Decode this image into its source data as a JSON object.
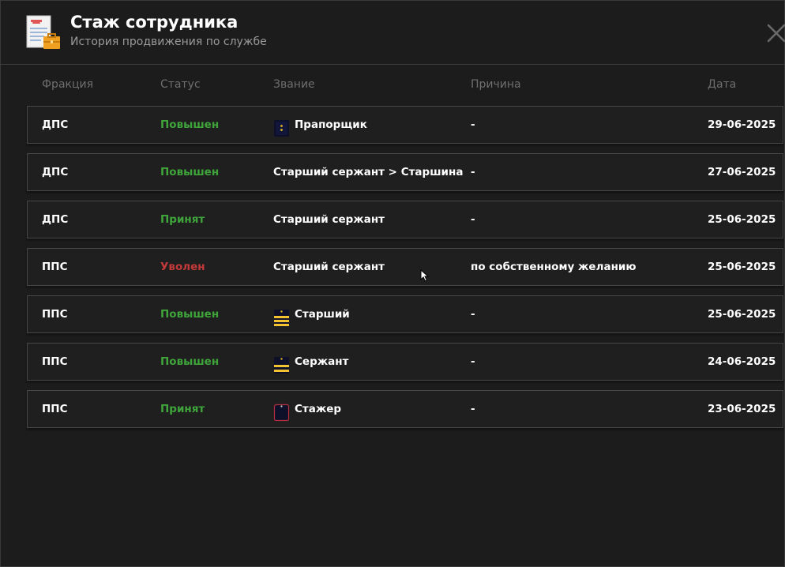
{
  "header": {
    "title": "Стаж сотрудника",
    "subtitle": "История продвижения по службе",
    "icon": "document-briefcase-icon"
  },
  "columns": {
    "faction": "Фракция",
    "status": "Статус",
    "rank": "Звание",
    "reason": "Причина",
    "date": "Дата"
  },
  "colors": {
    "promoted": "#3fa53b",
    "accepted": "#3fa53b",
    "fired": "#c43a3a",
    "background": "#1c1c1c"
  },
  "rows": [
    {
      "faction": "ДПС",
      "status": "Повышен",
      "rank": "Прапорщик",
      "rank_icon": "shoulder-board-star-icon",
      "reason": "-",
      "date": "29-06-2025"
    },
    {
      "faction": "ДПС",
      "status": "Повышен",
      "rank": "Старший сержант > Старшина",
      "rank_icon": "",
      "reason": "-",
      "date": "27-06-2025"
    },
    {
      "faction": "ДПС",
      "status": "Принят",
      "rank": "Старший сержант",
      "rank_icon": "",
      "reason": "-",
      "date": "25-06-2025"
    },
    {
      "faction": "ППС",
      "status": "Уволен",
      "rank": "Старший сержант",
      "rank_icon": "",
      "reason": "по собственному желанию",
      "date": "25-06-2025"
    },
    {
      "faction": "ППС",
      "status": "Повышен",
      "rank": "Старший",
      "rank_icon": "shoulder-board-stripes-icon",
      "reason": "-",
      "date": "25-06-2025"
    },
    {
      "faction": "ППС",
      "status": "Повышен",
      "rank": "Сержант",
      "rank_icon": "shoulder-board-stripes-icon",
      "reason": "-",
      "date": "24-06-2025"
    },
    {
      "faction": "ППС",
      "status": "Принят",
      "rank": "Стажер",
      "rank_icon": "shoulder-board-plain-icon",
      "reason": "-",
      "date": "23-06-2025"
    }
  ]
}
